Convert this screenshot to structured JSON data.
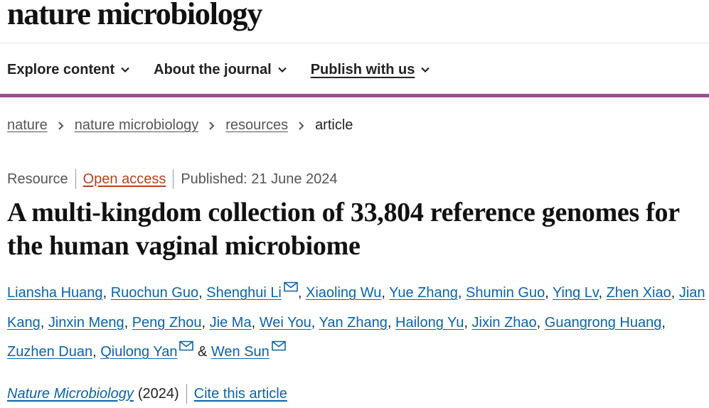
{
  "site": {
    "logo": "nature microbiology"
  },
  "nav": [
    {
      "label": "Explore content"
    },
    {
      "label": "About the journal"
    },
    {
      "label": "Publish with us"
    }
  ],
  "breadcrumb": {
    "items": [
      "nature",
      "nature microbiology",
      "resources"
    ],
    "current": "article"
  },
  "meta": {
    "type": "Resource",
    "access": "Open access",
    "published": "Published: 21 June 2024"
  },
  "title": "A multi-kingdom collection of 33,804 reference genomes for the human vaginal microbiome",
  "authors": [
    {
      "name": "Liansha Huang",
      "email": false
    },
    {
      "name": "Ruochun Guo",
      "email": false
    },
    {
      "name": "Shenghui Li",
      "email": true
    },
    {
      "name": "Xiaoling Wu",
      "email": false
    },
    {
      "name": "Yue Zhang",
      "email": false
    },
    {
      "name": "Shumin Guo",
      "email": false
    },
    {
      "name": "Ying Lv",
      "email": false
    },
    {
      "name": "Zhen Xiao",
      "email": false
    },
    {
      "name": "Jian Kang",
      "email": false
    },
    {
      "name": "Jinxin Meng",
      "email": false
    },
    {
      "name": "Peng Zhou",
      "email": false
    },
    {
      "name": "Jie Ma",
      "email": false
    },
    {
      "name": "Wei You",
      "email": false
    },
    {
      "name": "Yan Zhang",
      "email": false
    },
    {
      "name": "Hailong Yu",
      "email": false
    },
    {
      "name": "Jixin Zhao",
      "email": false
    },
    {
      "name": "Guangrong Huang",
      "email": false
    },
    {
      "name": "Zuzhen Duan",
      "email": false
    },
    {
      "name": "Qiulong Yan",
      "email": true
    },
    {
      "name": "Wen Sun",
      "email": true
    }
  ],
  "footer": {
    "journal": "Nature Microbiology",
    "year": "(2024)",
    "cite": "Cite this article"
  },
  "colors": {
    "accent_bar": "#9b4a96",
    "link": "#0b64a6",
    "open_access": "#b3431f"
  }
}
